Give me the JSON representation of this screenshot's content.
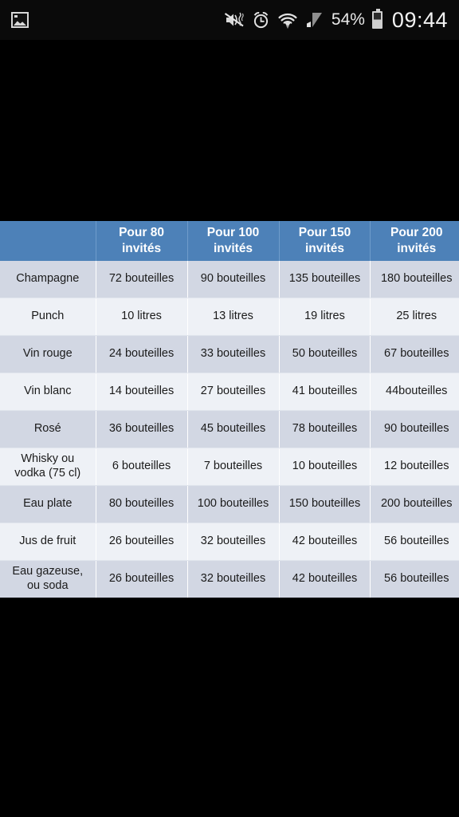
{
  "statusbar": {
    "gallery_icon": "gallery-icon",
    "mute_icon": "vibrate-mute-icon",
    "alarm_icon": "alarm-clock-icon",
    "wifi_icon": "wifi-icon",
    "signal_icon": "cellular-signal-icon",
    "battery_icon": "battery-icon",
    "battery_percent": "54%",
    "time": "09:44"
  },
  "table": {
    "corner_label": "",
    "headers": [
      "Pour 80\ninvités",
      "Pour 100\ninvités",
      "Pour 150\ninvités",
      "Pour 200\ninvités"
    ],
    "rows": [
      {
        "label": "Champagne",
        "values": [
          "72 bouteilles",
          "90 bouteilles",
          "135 bouteilles",
          "180 bouteilles"
        ]
      },
      {
        "label": "Punch",
        "values": [
          "10 litres",
          "13 litres",
          "19 litres",
          "25 litres"
        ]
      },
      {
        "label": "Vin rouge",
        "values": [
          "24 bouteilles",
          "33 bouteilles",
          "50 bouteilles",
          "67 bouteilles"
        ]
      },
      {
        "label": "Vin blanc",
        "values": [
          "14 bouteilles",
          "27 bouteilles",
          "41 bouteilles",
          "44bouteilles"
        ]
      },
      {
        "label": "Rosé",
        "values": [
          "36 bouteilles",
          "45 bouteilles",
          "78 bouteilles",
          "90 bouteilles"
        ]
      },
      {
        "label": "Whisky ou\nvodka (75 cl)",
        "values": [
          "6 bouteilles",
          "7 bouteilles",
          "10 bouteilles",
          "12 bouteilles"
        ]
      },
      {
        "label": "Eau plate",
        "values": [
          "80 bouteilles",
          "100 bouteilles",
          "150 bouteilles",
          "200 bouteilles"
        ]
      },
      {
        "label": "Jus de fruit",
        "values": [
          "26 bouteilles",
          "32 bouteilles",
          "42 bouteilles",
          "56 bouteilles"
        ]
      },
      {
        "label": "Eau gazeuse,\nou soda",
        "values": [
          "26 bouteilles",
          "32 bouteilles",
          "42 bouteilles",
          "56 bouteilles"
        ]
      }
    ]
  },
  "colors": {
    "header_blue": "#4d81b8",
    "row_odd": "#d2d7e3",
    "row_even": "#eef1f6",
    "page_background": "#000000"
  }
}
